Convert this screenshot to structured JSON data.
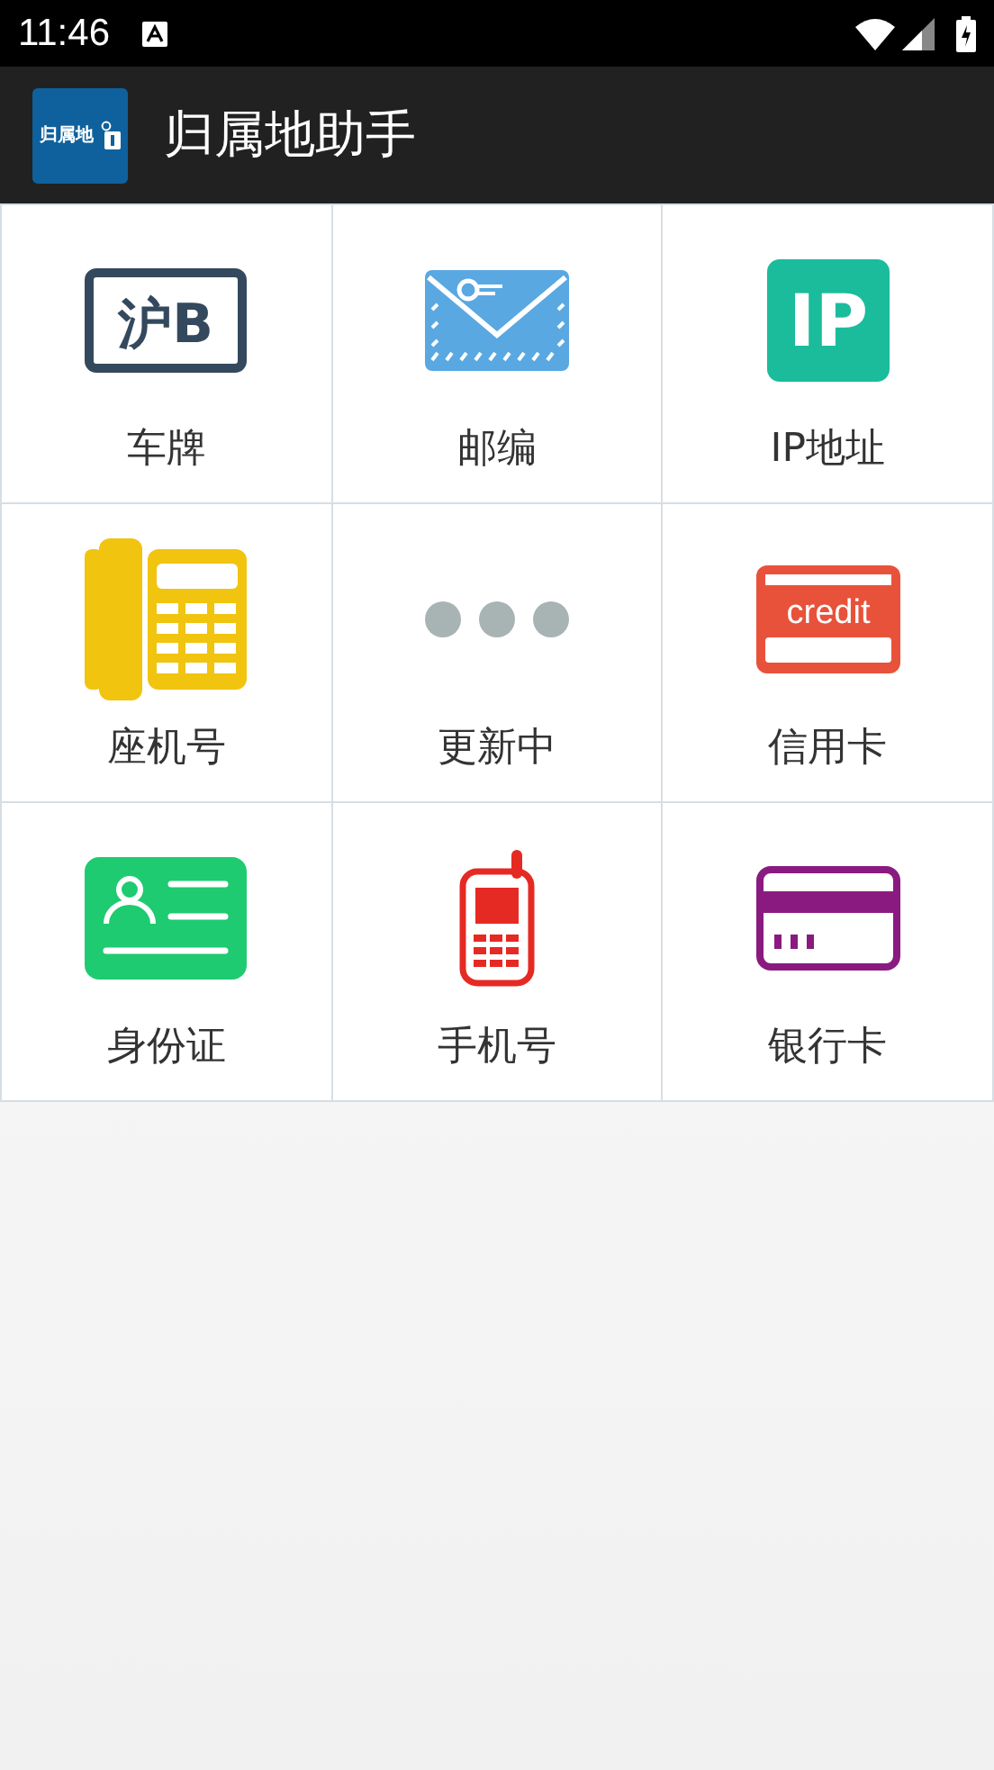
{
  "status_bar": {
    "time": "11:46"
  },
  "app_bar": {
    "logo_text": "归属地",
    "title": "归属地助手"
  },
  "grid": [
    {
      "kind": "plate",
      "label": "车牌",
      "icon_text": "沪B"
    },
    {
      "kind": "mail",
      "label": "邮编"
    },
    {
      "kind": "ip",
      "label": "IP地址",
      "icon_text": "IP"
    },
    {
      "kind": "landline",
      "label": "座机号"
    },
    {
      "kind": "loading",
      "label": "更新中"
    },
    {
      "kind": "credit",
      "label": "信用卡",
      "icon_text": "credit"
    },
    {
      "kind": "idcard",
      "label": "身份证"
    },
    {
      "kind": "mobile",
      "label": "手机号"
    },
    {
      "kind": "bank",
      "label": "银行卡"
    }
  ]
}
